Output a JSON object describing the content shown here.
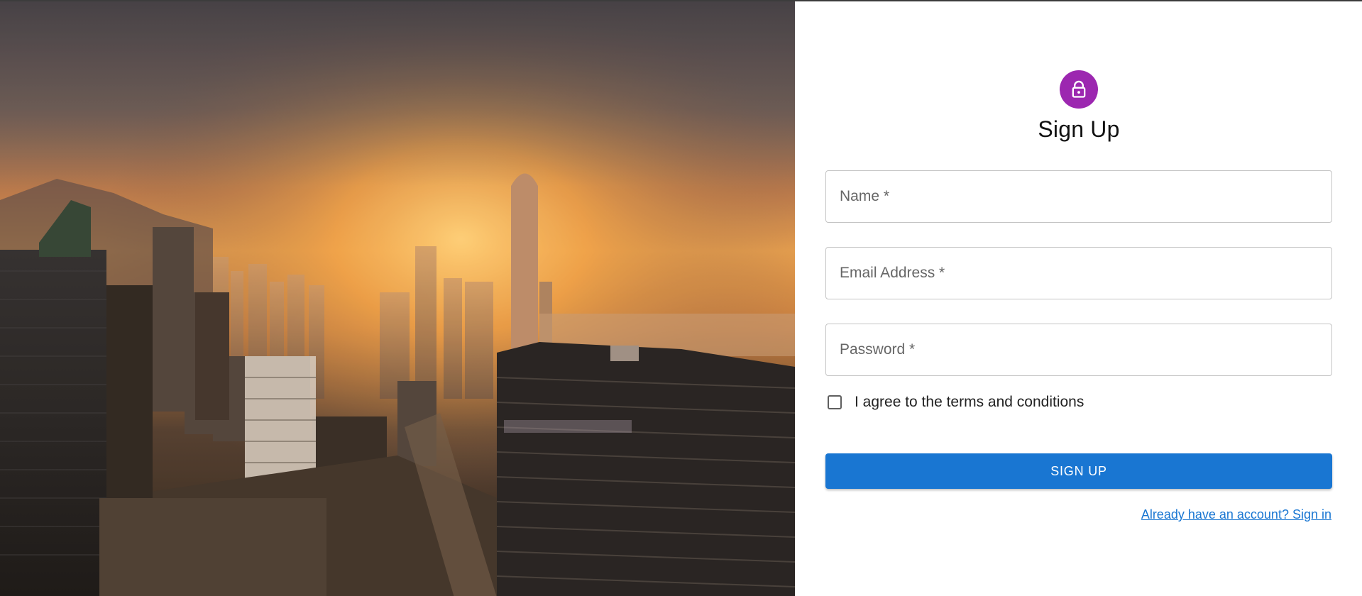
{
  "hero": {
    "image_description_icon": "city-skyline-photo"
  },
  "form": {
    "icon": "lock-icon",
    "avatar_color": "#9c27b0",
    "title": "Sign Up",
    "fields": {
      "name": {
        "label": "Name *",
        "value": ""
      },
      "email": {
        "label": "Email Address *",
        "value": ""
      },
      "password": {
        "label": "Password *",
        "value": ""
      }
    },
    "terms_label": "I agree to the terms and conditions",
    "terms_checked": false,
    "submit_label": "SIGN UP",
    "signin_link": "Already have an account? Sign in"
  },
  "colors": {
    "primary": "#1976d2",
    "secondary": "#9c27b0"
  }
}
